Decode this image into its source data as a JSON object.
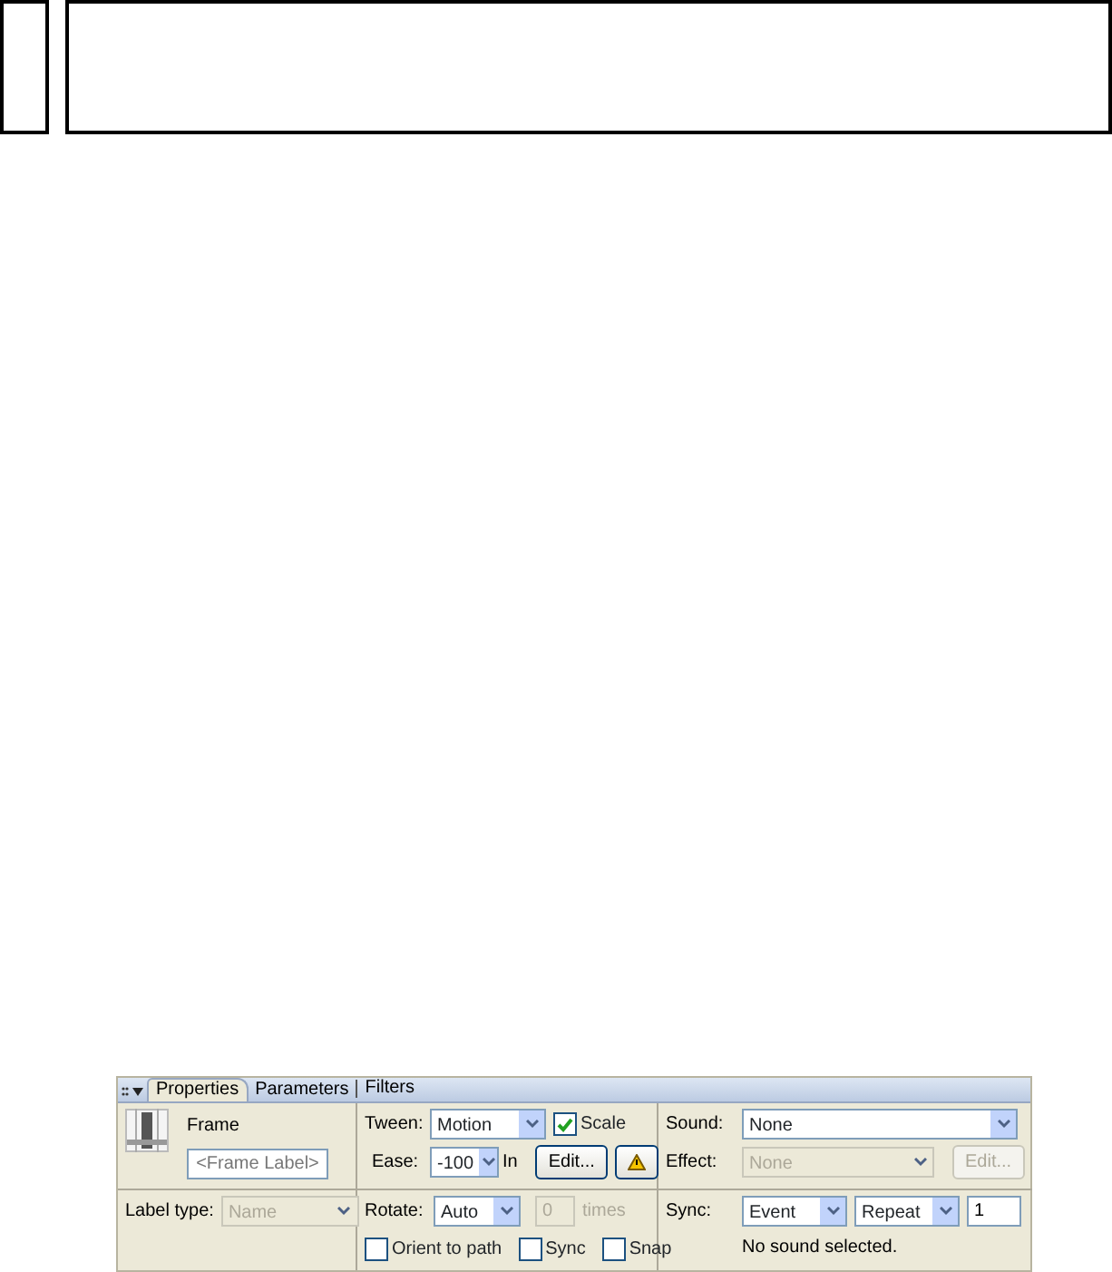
{
  "panel_tabs": [
    {
      "label": "Properties",
      "selected": true
    },
    {
      "label": "Parameters",
      "selected": false
    },
    {
      "label": "Filters",
      "selected": false
    }
  ],
  "frame": {
    "title": "Frame",
    "label_field": {
      "placeholder": "<Frame Label>"
    },
    "label_type": {
      "label": "Label type:",
      "value": "Name",
      "disabled": true
    }
  },
  "tween": {
    "label": "Tween:",
    "value": "Motion",
    "scale": {
      "label": "Scale",
      "checked": true
    },
    "ease": {
      "label": "Ease:",
      "value": "-100",
      "suffix": "In"
    },
    "edit_button": "Edit...",
    "rotate": {
      "label": "Rotate:",
      "value": "Auto"
    },
    "times": {
      "value": "0",
      "disabled": true,
      "label": "times"
    },
    "options": [
      {
        "label": "Orient to path",
        "checked": false
      },
      {
        "label": "Sync",
        "checked": false
      },
      {
        "label": "Snap",
        "checked": false
      }
    ]
  },
  "sound": {
    "label": "Sound:",
    "value": "None",
    "effect": {
      "label": "Effect:",
      "value": "None",
      "disabled": true
    },
    "edit_button": {
      "label": "Edit...",
      "disabled": true
    },
    "sync": {
      "label": "Sync:",
      "value": "Event",
      "repeat": "Repeat",
      "count": "1"
    },
    "status": "No sound selected."
  }
}
